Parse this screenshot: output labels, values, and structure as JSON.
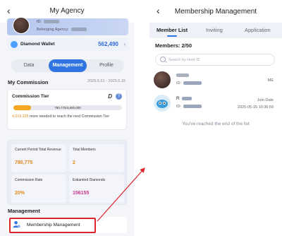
{
  "left": {
    "back_glyph": "‹",
    "title": "My Agency",
    "agency": {
      "id_label": "ID:",
      "belonging_label": "Belonging Agency:"
    },
    "wallet": {
      "label": "Diamond Wallet",
      "value": "562,490",
      "icon": "diamond-icon"
    },
    "tabs": [
      {
        "label": "Data"
      },
      {
        "label": "Management"
      },
      {
        "label": "Profile"
      }
    ],
    "commission": {
      "section_title": "My Commission",
      "date_range": "2025.5.01 - 2025.5.15",
      "tier_label": "Commission Tier",
      "tier_value": "D",
      "help_glyph": "?",
      "progress_text": "780,775/4,800,000",
      "progress_fraction": 0.163,
      "note_amount": "4,019,225",
      "note_text": " more needed to reach the next Commission Tier"
    },
    "stats": [
      {
        "label": "Current Period Total Revenue",
        "value": "780,775",
        "color": "#e0891c"
      },
      {
        "label": "Total Members",
        "value": "2",
        "color": "#e0891c"
      },
      {
        "label": "Commission Rate",
        "value": "20%",
        "color": "#e0891c"
      },
      {
        "label": "Estiamted Diamonds",
        "value": "156155",
        "color": "#c8338f"
      }
    ],
    "management": {
      "section_title": "Management",
      "item_label": "Membership Management",
      "icon": "member-management-icon"
    }
  },
  "right": {
    "back_glyph": "‹",
    "title": "Membership Management",
    "tabs": [
      {
        "label": "Member List"
      },
      {
        "label": "Inviting"
      },
      {
        "label": "Application"
      }
    ],
    "members_count": "Members: 2/50",
    "search_placeholder": "Search by Host ID",
    "members": [
      {
        "id_label": "ID:",
        "badge": "ME"
      },
      {
        "name_initial": "R",
        "id_label": "ID:",
        "join_label": "Join Date",
        "join_date": "2025-05-15 10:36:59"
      }
    ],
    "end_message": "You've reached the end of the list"
  },
  "colors": {
    "accent": "#2f74e0",
    "highlight": "#d9252b",
    "orange": "#e0891c"
  }
}
